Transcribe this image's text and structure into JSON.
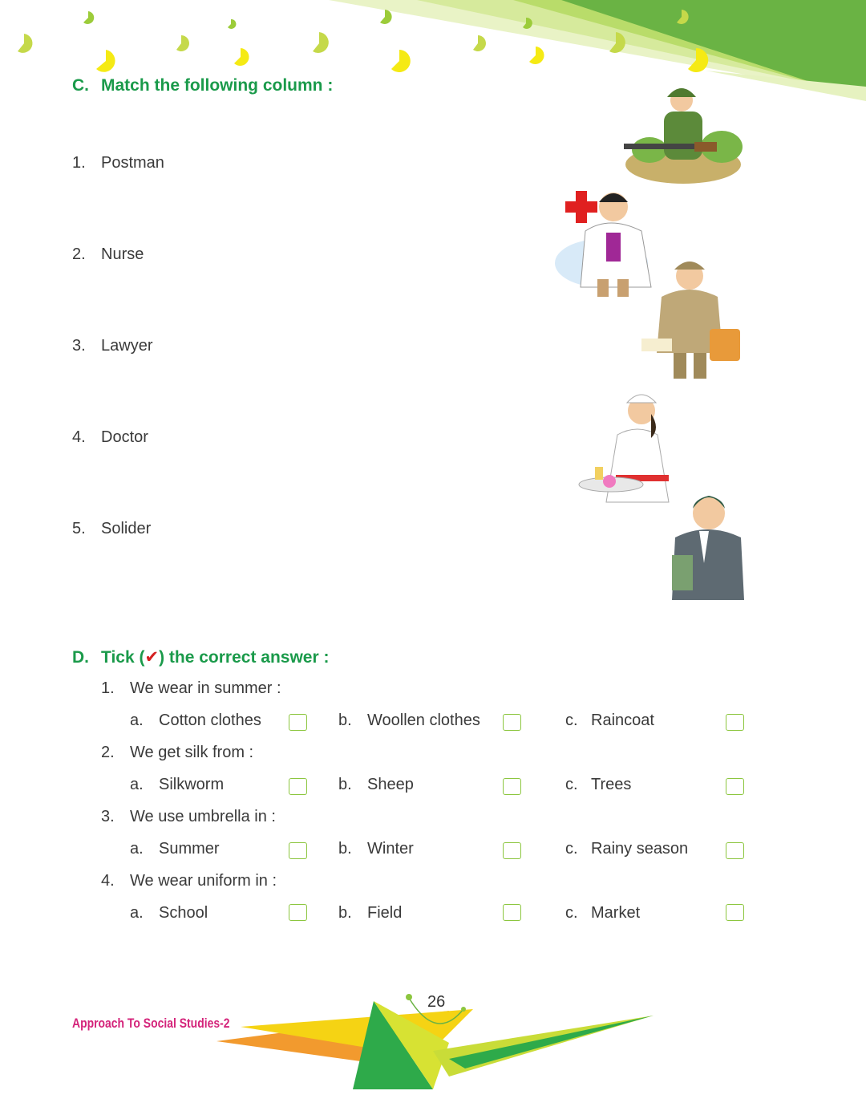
{
  "section_c": {
    "letter": "C.",
    "title": "Match the following column :",
    "items": [
      {
        "num": "1.",
        "text": "Postman"
      },
      {
        "num": "2.",
        "text": "Nurse"
      },
      {
        "num": "3.",
        "text": "Lawyer"
      },
      {
        "num": "4.",
        "text": "Doctor"
      },
      {
        "num": "5.",
        "text": "Solider"
      }
    ],
    "pictures": [
      "soldier-illustration",
      "doctor-illustration",
      "postman-illustration",
      "nurse-illustration",
      "lawyer-illustration"
    ]
  },
  "section_d": {
    "letter": "D.",
    "title_pre": "Tick (",
    "tick_mark": "✔",
    "title_post": ") the correct answer :",
    "questions": [
      {
        "num": "1.",
        "text": "We wear in summer :",
        "options": [
          {
            "l": "a.",
            "t": "Cotton clothes"
          },
          {
            "l": "b.",
            "t": "Woollen clothes"
          },
          {
            "l": "c.",
            "t": "Raincoat"
          }
        ]
      },
      {
        "num": "2.",
        "text": "We get silk from :",
        "options": [
          {
            "l": "a.",
            "t": "Silkworm"
          },
          {
            "l": "b.",
            "t": "Sheep"
          },
          {
            "l": "c.",
            "t": "Trees"
          }
        ]
      },
      {
        "num": "3.",
        "text": "We use umbrella in :",
        "options": [
          {
            "l": "a.",
            "t": "Summer"
          },
          {
            "l": "b.",
            "t": "Winter"
          },
          {
            "l": "c.",
            "t": "Rainy season"
          }
        ]
      },
      {
        "num": "4.",
        "text": "We wear uniform in :",
        "options": [
          {
            "l": "a.",
            "t": "School"
          },
          {
            "l": "b.",
            "t": "Field"
          },
          {
            "l": "c.",
            "t": "Market"
          }
        ]
      }
    ]
  },
  "footer": {
    "book_title": "Approach To Social Studies-2",
    "page_number": "26"
  },
  "colors": {
    "heading_green": "#1a9a4a",
    "brand_pink": "#d4237a",
    "checkbox_green": "#8cc63f",
    "banner_green": "#6ab344",
    "banner_lime": "#c8e07a",
    "dot_yellow": "#f5ea14"
  }
}
